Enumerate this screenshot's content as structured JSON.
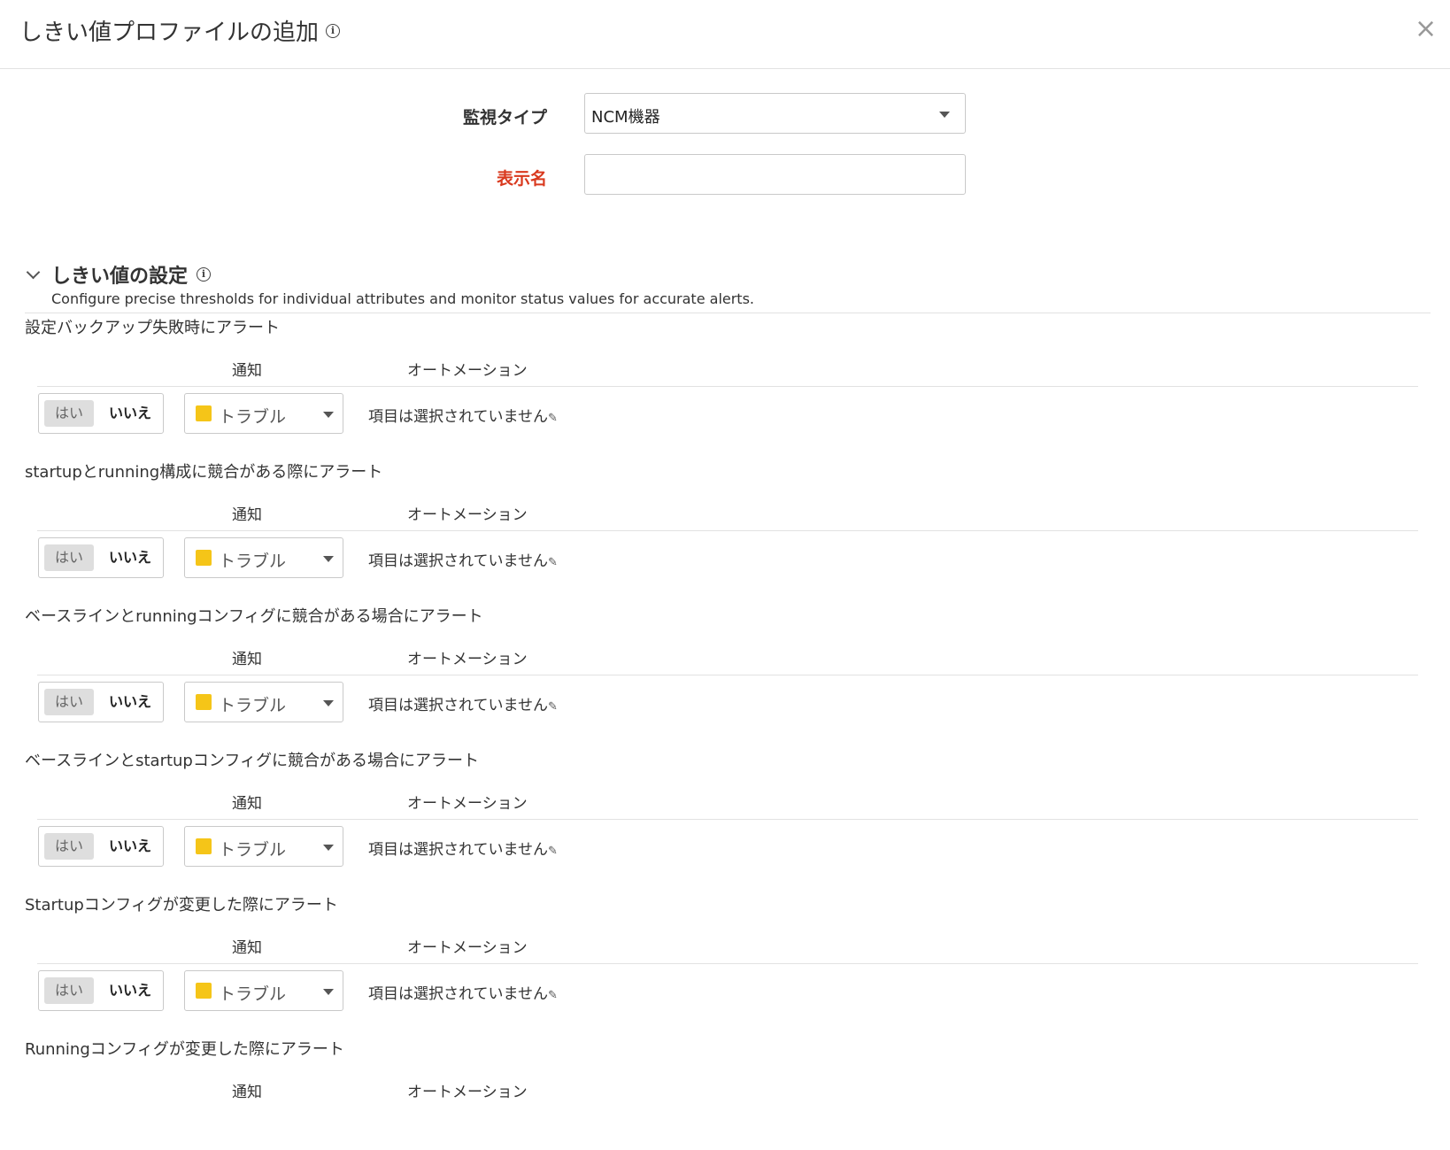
{
  "dialog": {
    "title": "しきい値プロファイルの追加",
    "close": "×"
  },
  "form": {
    "monitor_type_label": "監視タイプ",
    "monitor_type_value": "NCM機器",
    "display_name_label": "表示名",
    "display_name_value": ""
  },
  "section": {
    "title": "しきい値の設定",
    "description": "Configure precise thresholds for individual attributes and monitor status values for accurate alerts."
  },
  "columns": {
    "notify": "通知",
    "automation": "オートメーション"
  },
  "toggle": {
    "yes": "はい",
    "no": "いいえ",
    "selected": "いいえ"
  },
  "severity": {
    "label": "トラブル",
    "color": "#f5c518"
  },
  "automation_placeholder": "項目は選択されていません",
  "thresholds": [
    {
      "title": "設定バックアップ失敗時にアラート"
    },
    {
      "title": "startupとrunning構成に競合がある際にアラート"
    },
    {
      "title": "ベースラインとrunningコンフィグに競合がある場合にアラート"
    },
    {
      "title": "ベースラインとstartupコンフィグに競合がある場合にアラート"
    },
    {
      "title": "Startupコンフィグが変更した際にアラート"
    },
    {
      "title": "Runningコンフィグが変更した際にアラート"
    }
  ]
}
